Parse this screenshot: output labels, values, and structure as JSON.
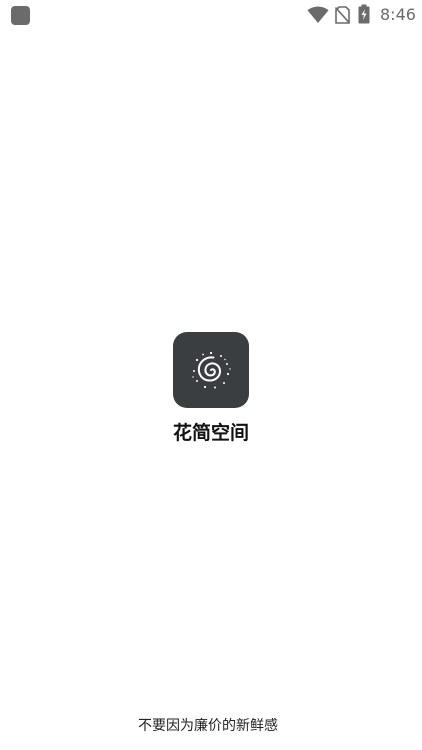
{
  "status_bar": {
    "time": "8:46",
    "icons": [
      "notification-icon",
      "wifi-icon",
      "no-sim-icon",
      "battery-charging-icon"
    ]
  },
  "splash": {
    "app_name": "花简空间",
    "logo_icon": "spiral-galaxy-icon",
    "logo_background": "#3b3e41"
  },
  "footer": {
    "slogan": "不要因为廉价的新鲜感"
  }
}
